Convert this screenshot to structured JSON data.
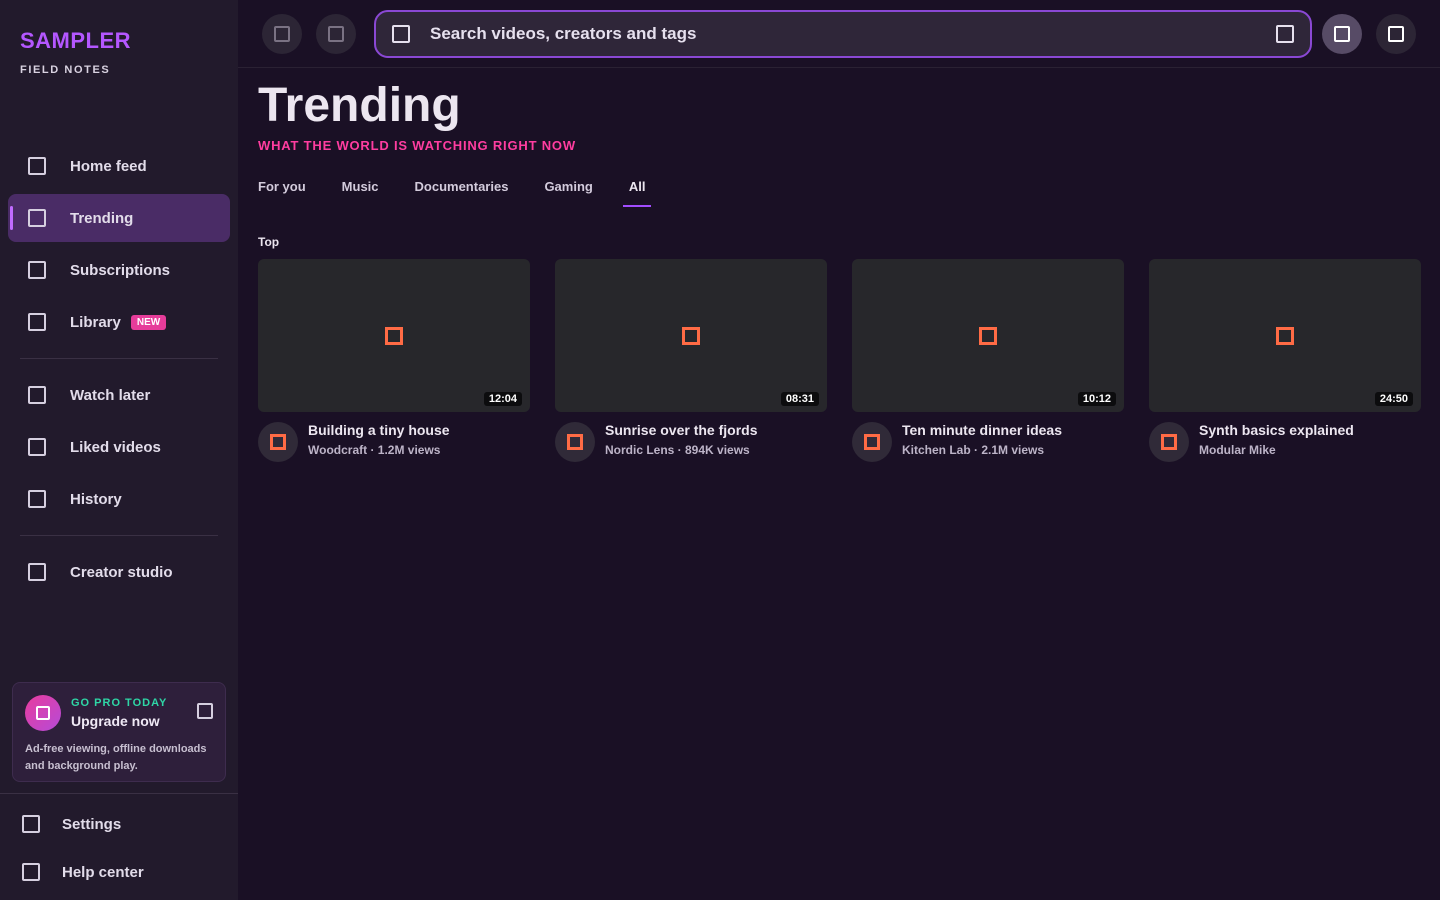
{
  "brand": {
    "name": "SAMPLER",
    "tagline": "FIELD NOTES"
  },
  "sidebar": {
    "items": [
      {
        "label": "Home feed",
        "icon": "home-icon"
      },
      {
        "label": "Trending",
        "icon": "flame-icon",
        "active": true
      },
      {
        "label": "Subscriptions",
        "icon": "subscriptions-icon"
      },
      {
        "label": "Library",
        "badge": "NEW",
        "icon": "library-icon"
      },
      {
        "label": "Watch later",
        "icon": "clock-icon"
      },
      {
        "label": "Liked videos",
        "icon": "heart-icon"
      },
      {
        "label": "History",
        "icon": "history-icon"
      },
      {
        "label": "Creator studio",
        "icon": "studio-icon"
      }
    ],
    "upgrade": {
      "kicker": "GO PRO TODAY",
      "title": "Upgrade now",
      "text": "Ad-free viewing, offline downloads and background play."
    },
    "bottom": [
      {
        "label": "Settings",
        "icon": "gear-icon"
      },
      {
        "label": "Help center",
        "icon": "help-icon"
      }
    ]
  },
  "search": {
    "placeholder": "Search videos, creators and tags"
  },
  "main": {
    "title": "Trending",
    "subtitle": "WHAT THE WORLD IS WATCHING RIGHT NOW",
    "tabs": [
      {
        "label": "For you"
      },
      {
        "label": "Music"
      },
      {
        "label": "Documentaries"
      },
      {
        "label": "Gaming"
      },
      {
        "label": "All",
        "active": true
      }
    ],
    "section": "Top",
    "videos": [
      {
        "title": "Building a tiny house",
        "sub": "Woodcraft · 1.2M views",
        "duration": "12:04"
      },
      {
        "title": "Sunrise over the fjords",
        "sub": "Nordic Lens · 894K views",
        "duration": "08:31"
      },
      {
        "title": "Ten minute dinner ideas",
        "sub": "Kitchen Lab · 2.1M views",
        "duration": "10:12"
      },
      {
        "title": "Synth basics explained",
        "sub": "Modular Mike",
        "duration": "24:50"
      }
    ]
  },
  "colors": {
    "accent": "#a24dff",
    "brand": "#b457ff",
    "subtitle": "#ff3da0",
    "icon_orange": "#ff6b45",
    "kicker_green": "#2fd6a6"
  }
}
